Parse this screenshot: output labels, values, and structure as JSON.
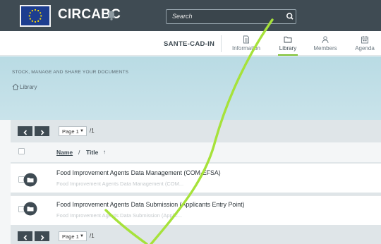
{
  "header": {
    "logo": "eu-flag",
    "app_title": "CIRCABC",
    "search_placeholder": "Search",
    "colors": {
      "topbar": "#3f4b53",
      "accent": "#7bbf2f"
    }
  },
  "subnav": {
    "group_name": "SANTE-CAD-IN",
    "tabs": [
      {
        "label": "Information",
        "icon": "document-icon"
      },
      {
        "label": "Library",
        "icon": "folder-icon",
        "active": true
      },
      {
        "label": "Members",
        "icon": "members-icon"
      },
      {
        "label": "Agenda",
        "icon": "calendar-icon"
      }
    ]
  },
  "banner": {
    "tagline": "STOCK, MANAGE AND SHARE YOUR DOCUMENTS",
    "breadcrumb": "Library"
  },
  "pager": {
    "page_label": "Page 1",
    "total": "/1"
  },
  "list": {
    "header": {
      "name": "Name",
      "separator": "/",
      "title": "Title",
      "sort": "↑"
    },
    "rows": [
      {
        "name": "Food Improvement Agents Data Management (COM-EFSA)",
        "title": "Food Improvement Agents Data Management (COM..."
      },
      {
        "name": "Food Improvement Agents Data Submission (Applicants Entry Point)",
        "title": "Food Improvement Agents Data Submission (Applic..."
      }
    ]
  }
}
